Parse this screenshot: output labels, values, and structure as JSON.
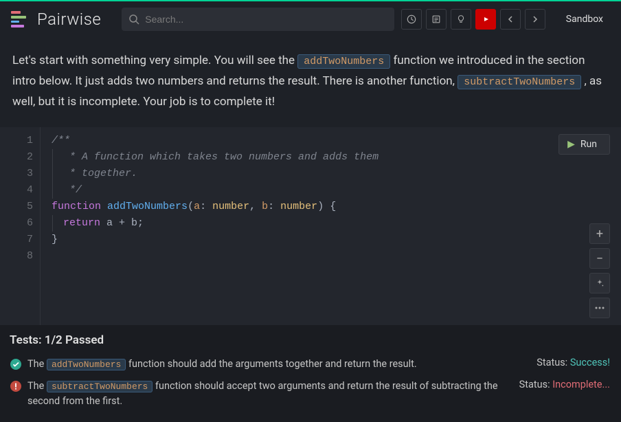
{
  "header": {
    "brand": "Pairwise",
    "search_placeholder": "Search...",
    "sandbox": "Sandbox"
  },
  "instructions": {
    "part1": "Let's start with something very simple. You will see the ",
    "code1": "addTwoNumbers",
    "part2": " function we introduced in the section intro below. It just adds two numbers and returns the result. There is another function, ",
    "code2": "subtractTwoNumbers",
    "part3": " , as well, but it is incomplete. Your job is to complete it!"
  },
  "editor": {
    "line_count": 8,
    "run_label": "Run",
    "lines": {
      "l1": "/**",
      "l2": " * A function which takes two numbers and adds them",
      "l3": " * together.",
      "l4": " */",
      "l5_kw": "function",
      "l5_fn": "addTwoNumbers",
      "l5_p1": "a",
      "l5_t1": "number",
      "l5_p2": "b",
      "l5_t2": "number",
      "l6_kw": "return",
      "l6_expr": "a + b",
      "l7": "}"
    }
  },
  "tests": {
    "header": "Tests: 1/2 Passed",
    "status_label": "Status:",
    "items": [
      {
        "pre": "The ",
        "code": "addTwoNumbers",
        "post": " function should add the arguments together and return the result.",
        "status": "Success!",
        "passed": true
      },
      {
        "pre": "The ",
        "code": "subtractTwoNumbers",
        "post": " function should accept two arguments and return the result of subtracting the second from the first.",
        "status": "Incomplete...",
        "passed": false
      }
    ]
  }
}
